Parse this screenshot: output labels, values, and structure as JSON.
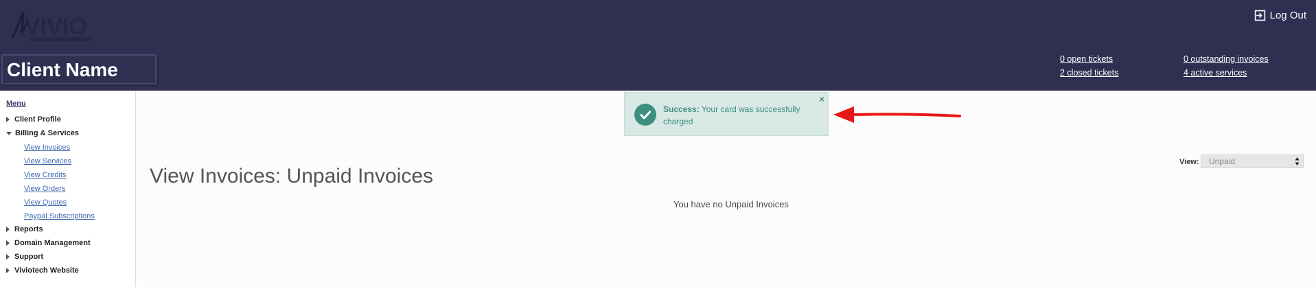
{
  "header": {
    "logo_text": "VIVIO",
    "client_name": "Client Name",
    "logout_label": "Log Out",
    "stats": {
      "open_tickets": "0 open tickets",
      "closed_tickets": "2 closed tickets",
      "outstanding_invoices": "0 outstanding invoices",
      "active_services": "4 active services"
    }
  },
  "sidebar": {
    "menu_label": "Menu",
    "items": [
      {
        "label": "Client Profile"
      },
      {
        "label": "Billing & Services"
      },
      {
        "label": "Reports"
      },
      {
        "label": "Domain Management"
      },
      {
        "label": "Support"
      },
      {
        "label": "Viviotech Website"
      }
    ],
    "billing_subitems": [
      {
        "label": "View Invoices"
      },
      {
        "label": "View Services"
      },
      {
        "label": "View Credits"
      },
      {
        "label": "View Orders"
      },
      {
        "label": "View Quotes"
      },
      {
        "label": "Paypal Subscriptions"
      }
    ]
  },
  "alert": {
    "prefix": "Success:",
    "message": "Your card was successfully charged",
    "close": "×"
  },
  "main": {
    "title": "View Invoices: Unpaid Invoices",
    "view_label": "View:",
    "view_value": "Unpaid",
    "empty_message": "You have no Unpaid Invoices"
  },
  "colors": {
    "header_bg": "#2f2f52",
    "alert_bg": "#d8e8e4",
    "alert_text": "#3f8f80",
    "link": "#3d68b0",
    "arrow": "#e81818"
  },
  "icons": {
    "logout": "logout-icon",
    "alert": "check-circle-icon",
    "arrow": "red-arrow-annotation"
  }
}
